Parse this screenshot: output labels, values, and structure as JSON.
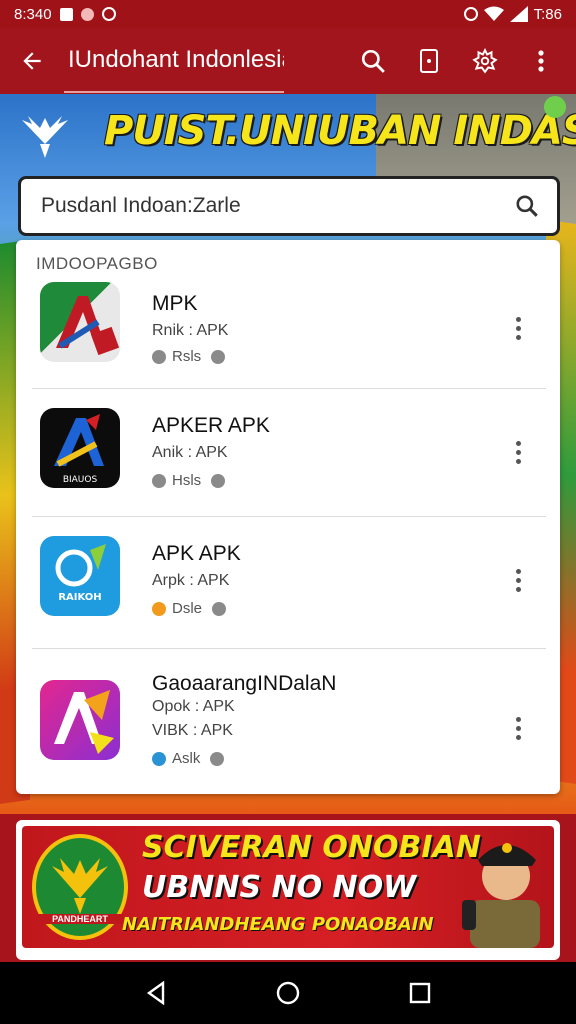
{
  "status_bar": {
    "time": "8:340",
    "right_text": "T:86"
  },
  "app_bar": {
    "title": "IUndohant Indonlesia",
    "icons": [
      "back-arrow-icon",
      "search-icon",
      "phone-icon",
      "settings-icon",
      "more-vert-icon"
    ]
  },
  "hero": {
    "title": "PUIST.UNIUBAN INDASA"
  },
  "search": {
    "value": "Pusdanl Indoan:Zarle",
    "icon": "search-icon"
  },
  "results": {
    "section_label": "IMDOOPAGBO",
    "items": [
      {
        "name": "MPK",
        "meta": [
          "Rnik : APK"
        ],
        "badge_label": "Rsls",
        "badge_color": "#8a8a8a",
        "icon_label": ""
      },
      {
        "name": "APKER APK",
        "meta": [
          "Anik : APK"
        ],
        "badge_label": "Hsls",
        "badge_color": "#8a8a8a",
        "icon_label": "BIAUOS"
      },
      {
        "name": "APK APK",
        "meta": [
          "Arpk : APK"
        ],
        "badge_label": "Dsle",
        "badge_color": "#f29a1c",
        "icon_label": "RAIKOH"
      },
      {
        "name": "GaoaarangINDalaN",
        "meta": [
          "Opok : APK",
          "VIBK : APK"
        ],
        "badge_label": "Aslk",
        "badge_color": "#2a93d5",
        "icon_label": ""
      }
    ]
  },
  "promo": {
    "line1": "SCIVERAN ONOBIAN",
    "line2": "UBNNS NO NOW",
    "line3": "NAITRIANDHEANG PONAOBAIN",
    "emblem_label": "PANDHEART"
  },
  "colors": {
    "primary": "#a3151c",
    "accent_yellow": "#f7e51b"
  }
}
